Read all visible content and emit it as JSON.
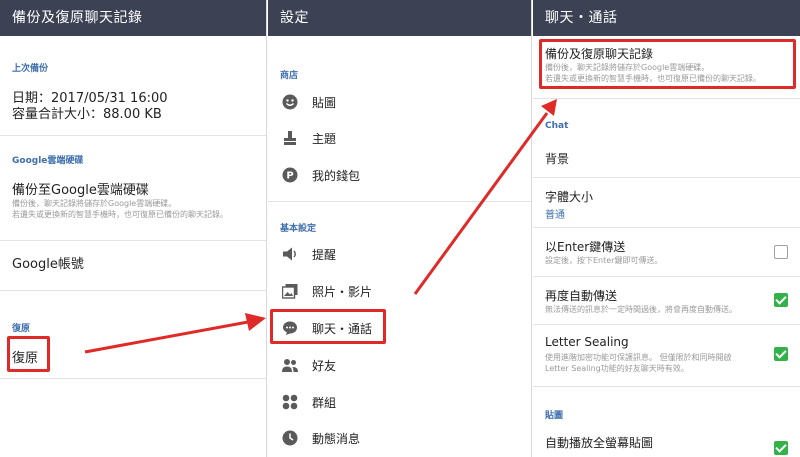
{
  "left_panel": {
    "title": "備份及復原聊天記錄",
    "last_backup_header": "上次備份",
    "date_line": "日期：2017/05/31  16:00",
    "size_line": "容量合計大小：88.00 KB",
    "gdrive_header": "Google雲端硬碟",
    "backup_title": "備份至Google雲端硬碟",
    "backup_desc1": "備份後，聊天記錄將儲存於Google雲端硬碟。",
    "backup_desc2": "若遺失或更換新的智慧手機時，也可復原已備份的聊天記錄。",
    "account_label": "Google帳號",
    "restore_header": "復原",
    "restore_label": "復原"
  },
  "middle_panel": {
    "title": "設定",
    "shop_header": "商店",
    "shop_items": [
      {
        "label": "貼圖",
        "icon": "smiley-icon"
      },
      {
        "label": "主題",
        "icon": "brush-icon"
      },
      {
        "label": "我的錢包",
        "icon": "wallet-p-icon"
      }
    ],
    "basic_header": "基本設定",
    "basic_items": [
      {
        "label": "提醒",
        "icon": "speaker-icon"
      },
      {
        "label": "照片・影片",
        "icon": "photo-icon"
      },
      {
        "label": "聊天・通話",
        "icon": "chat-bubble-icon"
      },
      {
        "label": "好友",
        "icon": "friends-icon"
      },
      {
        "label": "群組",
        "icon": "group-icon"
      },
      {
        "label": "動態消息",
        "icon": "clock-icon"
      }
    ]
  },
  "right_panel": {
    "title": "聊天・通話",
    "backup_title": "備份及復原聊天記錄",
    "backup_desc1": "備份後，聊天記錄將儲存於Google雲端硬碟。",
    "backup_desc2": "若遺失或更換新的智慧手機時，也可復原已備份的聊天記錄。",
    "chat_header": "Chat",
    "background_label": "背景",
    "font_size_label": "字體大小",
    "font_size_value": "普通",
    "enter_send_label": "以Enter鍵傳送",
    "enter_send_desc": "設定後，按下Enter鍵即可傳送。",
    "enter_send_checked": false,
    "auto_resend_label": "再度自動傳送",
    "auto_resend_desc": "無法傳送的訊息於一定時間過後，將會再度自動傳送。",
    "auto_resend_checked": true,
    "letter_sealing_label": "Letter Sealing",
    "letter_sealing_desc1": "使用進階加密功能可保護訊息。 但僅限於和同時開啟",
    "letter_sealing_desc2": "Letter Sealing功能的好友聊天時有效。",
    "letter_sealing_checked": true,
    "sticker_header": "貼圖",
    "autoplay_label": "自動播放全螢幕貼圖",
    "autoplay_checked": true
  },
  "colors": {
    "header_bg": "#3c4153",
    "section_blue": "#3f6fae",
    "highlight_red": "#e02a27",
    "check_green": "#34b24a"
  }
}
